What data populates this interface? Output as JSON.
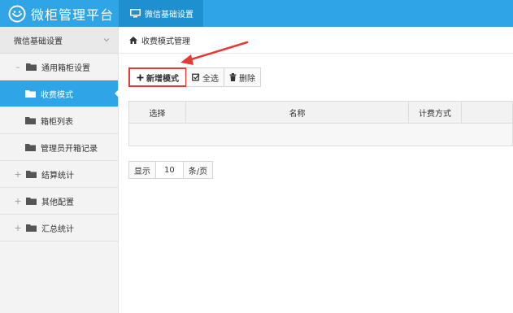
{
  "app": {
    "title": "微柜管理平台"
  },
  "topnav": {
    "tab_label": "微信基础设置"
  },
  "sidebar": {
    "header": "微信基础设置",
    "items": [
      {
        "label": "通用箱柜设置",
        "prefix": "–"
      },
      {
        "label": "收费模式"
      },
      {
        "label": "箱柜列表"
      },
      {
        "label": "管理员开箱记录"
      },
      {
        "label": "结算统计",
        "prefix": "+"
      },
      {
        "label": "其他配置",
        "prefix": "+"
      },
      {
        "label": "汇总统计",
        "prefix": "+"
      }
    ]
  },
  "breadcrumb": {
    "text": "收费模式管理"
  },
  "toolbar": {
    "add_label": "新增模式",
    "select_all_label": "全选",
    "delete_label": "删除"
  },
  "table": {
    "columns": [
      "选择",
      "名称",
      "计费方式"
    ]
  },
  "pager": {
    "show_label": "显示",
    "page_size": "10",
    "unit_label": "条/页"
  },
  "colors": {
    "primary": "#2fa4e7",
    "primary_dark": "#1e8fcf",
    "highlight": "#e53935"
  }
}
